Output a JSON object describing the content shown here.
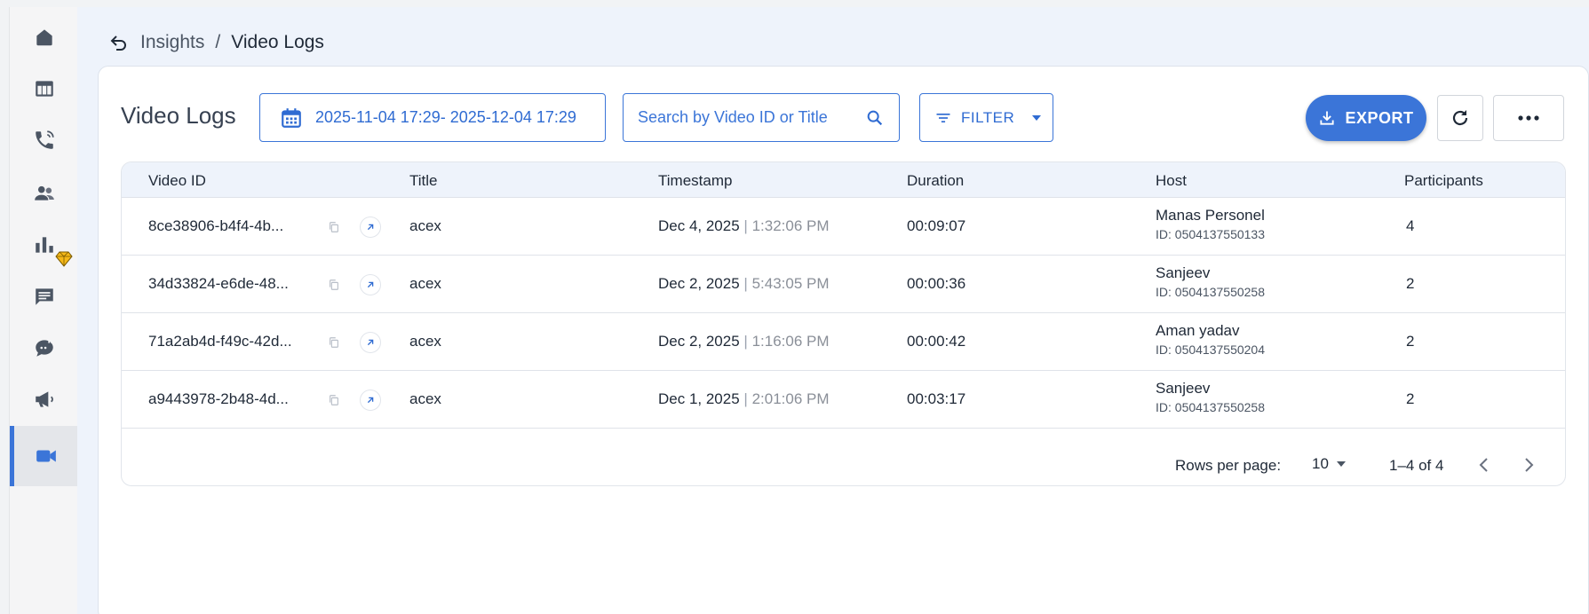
{
  "sidebar": {
    "items": [
      {
        "icon": "home-icon"
      },
      {
        "icon": "table-icon"
      },
      {
        "icon": "phone-icon"
      },
      {
        "icon": "users-icon"
      },
      {
        "icon": "bar-chart-icon",
        "badge": "gem-icon"
      },
      {
        "icon": "message-icon"
      },
      {
        "icon": "chat-analytics-icon"
      },
      {
        "icon": "megaphone-icon"
      },
      {
        "icon": "video-camera-icon",
        "active": true
      }
    ]
  },
  "breadcrumb": {
    "parent": "Insights",
    "separator": "/",
    "current": "Video Logs"
  },
  "toolbar": {
    "title": "Video Logs",
    "date_range": "2025-11-04 17:29- 2025-12-04 17:29",
    "search_placeholder": "Search by Video ID or Title",
    "filter_label": "FILTER",
    "export_label": "EXPORT"
  },
  "table": {
    "columns": [
      "Video ID",
      "Title",
      "Timestamp",
      "Duration",
      "Host",
      "Participants"
    ],
    "rows": [
      {
        "video_id": "8ce38906-b4f4-4b...",
        "title": "acex",
        "date": "Dec 4, 2025",
        "sep": "|",
        "time": "1:32:06 PM",
        "duration": "00:09:07",
        "host_name": "Manas Personel",
        "host_id": "ID: 0504137550133",
        "participants": "4"
      },
      {
        "video_id": "34d33824-e6de-48...",
        "title": "acex",
        "date": "Dec 2, 2025",
        "sep": "|",
        "time": "5:43:05 PM",
        "duration": "00:00:36",
        "host_name": "Sanjeev",
        "host_id": "ID: 0504137550258",
        "participants": "2"
      },
      {
        "video_id": "71a2ab4d-f49c-42d...",
        "title": "acex",
        "date": "Dec 2, 2025",
        "sep": "|",
        "time": "1:16:06 PM",
        "duration": "00:00:42",
        "host_name": "Aman yadav",
        "host_id": "ID: 0504137550204",
        "participants": "2"
      },
      {
        "video_id": "a9443978-2b48-4d...",
        "title": "acex",
        "date": "Dec 1, 2025",
        "sep": "|",
        "time": "2:01:06 PM",
        "duration": "00:03:17",
        "host_name": "Sanjeev",
        "host_id": "ID: 0504137550258",
        "participants": "2"
      }
    ]
  },
  "pagination": {
    "rows_per_page_label": "Rows per page:",
    "rows_per_page_value": "10",
    "range": "1–4 of 4"
  },
  "colors": {
    "accent": "#3b75d8",
    "header_bg": "#eef3fb",
    "gem": "#f5b818"
  }
}
